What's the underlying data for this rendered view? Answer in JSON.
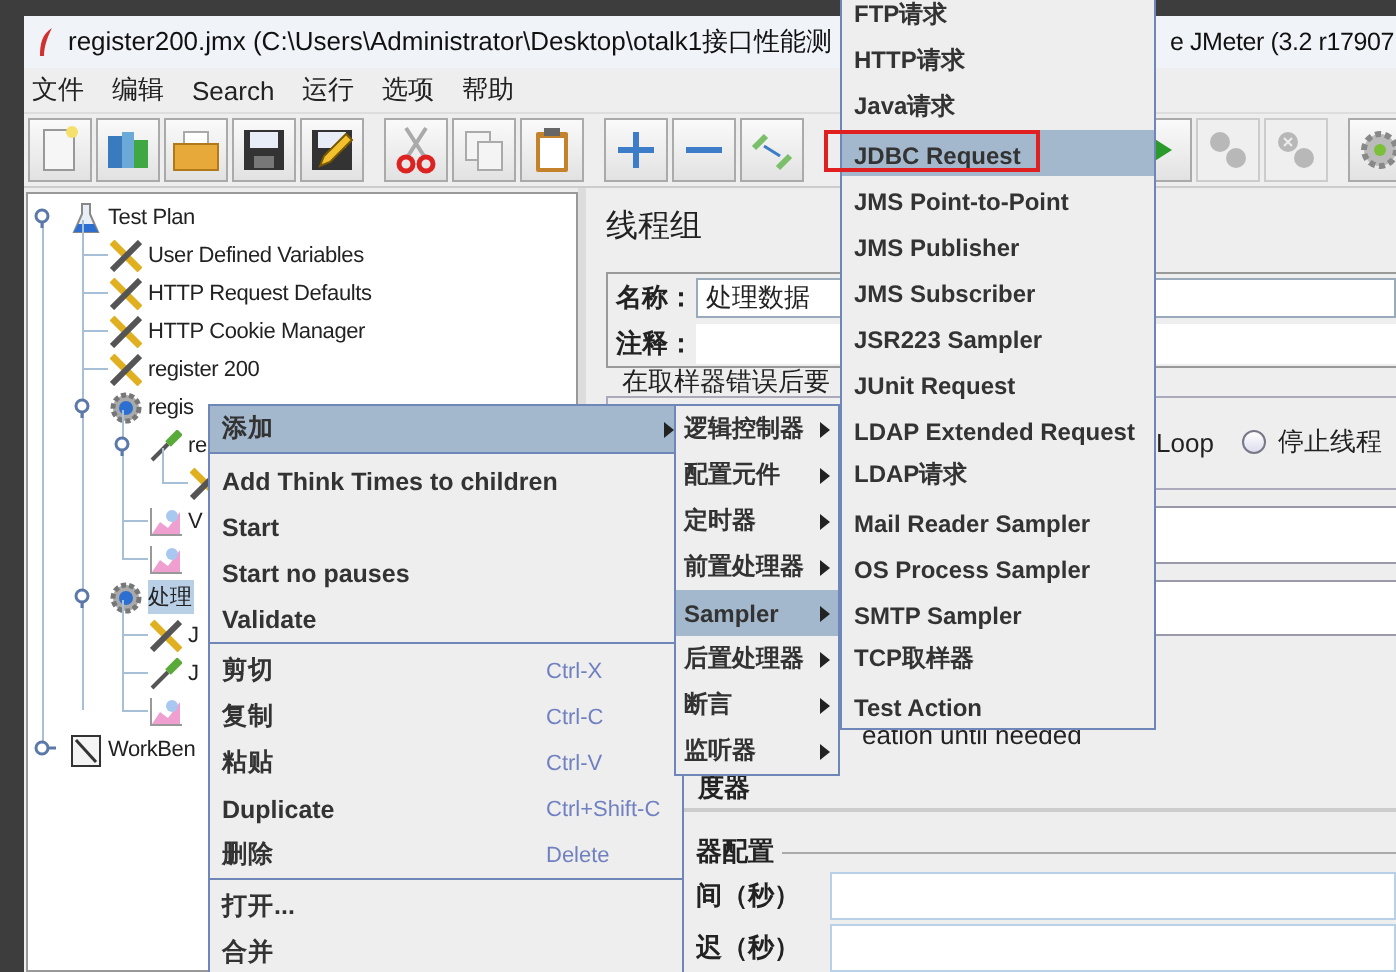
{
  "window": {
    "title": "register200.jmx (C:\\Users\\Administrator\\Desktop\\otalk1接口性能测",
    "title_tail": "e JMeter (3.2 r17907"
  },
  "menu_bar": [
    "文件",
    "编辑",
    "Search",
    "运行",
    "选项",
    "帮助"
  ],
  "toolbar": [
    [
      {
        "kind": "new",
        "disabled": false
      },
      {
        "kind": "templates",
        "disabled": false
      },
      {
        "kind": "open",
        "disabled": false
      },
      {
        "kind": "save",
        "disabled": false
      },
      {
        "kind": "save-as",
        "disabled": false
      }
    ],
    [
      {
        "kind": "cut",
        "disabled": false
      },
      {
        "kind": "copy",
        "disabled": false
      },
      {
        "kind": "paste",
        "disabled": false
      }
    ],
    [
      {
        "kind": "expand",
        "disabled": false
      },
      {
        "kind": "collapse",
        "disabled": false
      },
      {
        "kind": "toggle",
        "disabled": false
      }
    ],
    [
      {
        "kind": "start",
        "disabled": false
      },
      {
        "kind": "stop",
        "disabled": true
      },
      {
        "kind": "shutdown",
        "disabled": true
      }
    ],
    [
      {
        "kind": "remote",
        "disabled": false
      }
    ]
  ],
  "tree": [
    {
      "label": "Test Plan",
      "kind": "test-plan",
      "expanded": true,
      "selected": false,
      "children": [
        {
          "label": "User Defined Variables",
          "kind": "config",
          "selected": false
        },
        {
          "label": "HTTP Request Defaults",
          "kind": "config",
          "selected": false
        },
        {
          "label": "HTTP Cookie Manager",
          "kind": "config",
          "selected": false
        },
        {
          "label": "register 200",
          "kind": "config",
          "selected": false
        },
        {
          "label": "regis",
          "kind": "thread-group",
          "expanded": true,
          "selected": false,
          "children": [
            {
              "label": "re",
              "kind": "sampler",
              "expanded": true,
              "selected": false,
              "children": [
                {
                  "kind": "config",
                  "selected": false
                }
              ]
            },
            {
              "label": "V",
              "kind": "listener",
              "selected": false
            },
            {
              "kind": "listener",
              "selected": false
            }
          ]
        },
        {
          "label": "处理",
          "kind": "thread-group",
          "expanded": true,
          "selected": true,
          "children": [
            {
              "label": "J",
              "kind": "config",
              "selected": false
            },
            {
              "label": "J",
              "kind": "sampler",
              "selected": false
            },
            {
              "kind": "listener",
              "selected": false
            }
          ]
        }
      ]
    },
    {
      "label": "WorkBen",
      "kind": "workbench",
      "expanded": false,
      "selected": false
    }
  ],
  "thread_group": {
    "title": "线程组",
    "name_label": "名称：",
    "name_value": "处理数据",
    "comment_label": "注释：",
    "error_action_legend": "在取样器错误后要",
    "loop_text": "Loop",
    "radio": {
      "label": "停止线程",
      "selected": false
    },
    "delay_text": "eation until needed",
    "scheduler_text": "度器",
    "scheduler_legend": "器配置",
    "duration_label": "间（秒）",
    "delay_label": "迟（秒）"
  },
  "context_menu": [
    {
      "kind": "submenu",
      "label": "添加",
      "selected": true
    },
    {
      "kind": "separator"
    },
    {
      "kind": "item",
      "label": "Add Think Times to children",
      "selected": false
    },
    {
      "kind": "item",
      "label": "Start",
      "selected": false
    },
    {
      "kind": "item",
      "label": "Start no pauses",
      "selected": false
    },
    {
      "kind": "item",
      "label": "Validate",
      "selected": false
    },
    {
      "kind": "separator"
    },
    {
      "kind": "item",
      "label": "剪切",
      "shortcut": "Ctrl-X",
      "selected": false
    },
    {
      "kind": "item",
      "label": "复制",
      "shortcut": "Ctrl-C",
      "selected": false
    },
    {
      "kind": "item",
      "label": "粘贴",
      "shortcut": "Ctrl-V",
      "selected": false
    },
    {
      "kind": "item",
      "label": "Duplicate",
      "shortcut": "Ctrl+Shift-C",
      "selected": false
    },
    {
      "kind": "item",
      "label": "删除",
      "shortcut": "Delete",
      "selected": false
    },
    {
      "kind": "separator"
    },
    {
      "kind": "item",
      "label": "打开...",
      "selected": false
    },
    {
      "kind": "item",
      "label": "合并",
      "selected": false
    }
  ],
  "add_submenu": [
    {
      "label": "逻辑控制器",
      "selected": false
    },
    {
      "label": "配置元件",
      "selected": false
    },
    {
      "label": "定时器",
      "selected": false
    },
    {
      "label": "前置处理器",
      "selected": false
    },
    {
      "label": "Sampler",
      "selected": true
    },
    {
      "label": "后置处理器",
      "selected": false
    },
    {
      "label": "断言",
      "selected": false
    },
    {
      "label": "监听器",
      "selected": false
    }
  ],
  "sampler_submenu": [
    {
      "label": "FTP请求",
      "selected": false,
      "outlined": false
    },
    {
      "label": "HTTP请求",
      "selected": false,
      "outlined": false
    },
    {
      "label": "Java请求",
      "selected": false,
      "outlined": false
    },
    {
      "label": "JDBC Request",
      "selected": true,
      "outlined": true
    },
    {
      "label": "JMS Point-to-Point",
      "selected": false,
      "outlined": false
    },
    {
      "label": "JMS Publisher",
      "selected": false,
      "outlined": false
    },
    {
      "label": "JMS Subscriber",
      "selected": false,
      "outlined": false
    },
    {
      "label": "JSR223 Sampler",
      "selected": false,
      "outlined": false
    },
    {
      "label": "JUnit Request",
      "selected": false,
      "outlined": false
    },
    {
      "label": "LDAP Extended Request",
      "selected": false,
      "outlined": false
    },
    {
      "label": "LDAP请求",
      "selected": false,
      "outlined": false
    },
    {
      "label": "Mail Reader Sampler",
      "selected": false,
      "outlined": false
    },
    {
      "label": "OS Process Sampler",
      "selected": false,
      "outlined": false
    },
    {
      "label": "SMTP Sampler",
      "selected": false,
      "outlined": false
    },
    {
      "label": "TCP取样器",
      "selected": false,
      "outlined": false
    },
    {
      "label": "Test Action",
      "selected": false,
      "outlined": false
    }
  ]
}
